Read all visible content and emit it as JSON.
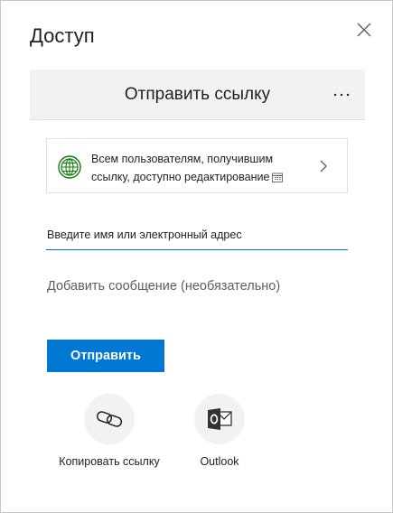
{
  "dialog": {
    "title": "Доступ"
  },
  "header": {
    "title": "Отправить ссылку"
  },
  "permission": {
    "line1": "Всем пользователям, получившим",
    "line2": "ссылку, доступно редактирование"
  },
  "form": {
    "recipient_placeholder": "Введите имя или электронный адрес",
    "message_placeholder": "Добавить сообщение (необязательно)",
    "send_label": "Отправить"
  },
  "actions": [
    {
      "label": "Копировать ссылку",
      "icon": "link-icon"
    },
    {
      "label": "Outlook",
      "icon": "outlook-icon"
    }
  ],
  "colors": {
    "accent": "#0078d4",
    "globe": "#107c10",
    "panel": "#f3f2f1",
    "outlook": "#333333"
  }
}
